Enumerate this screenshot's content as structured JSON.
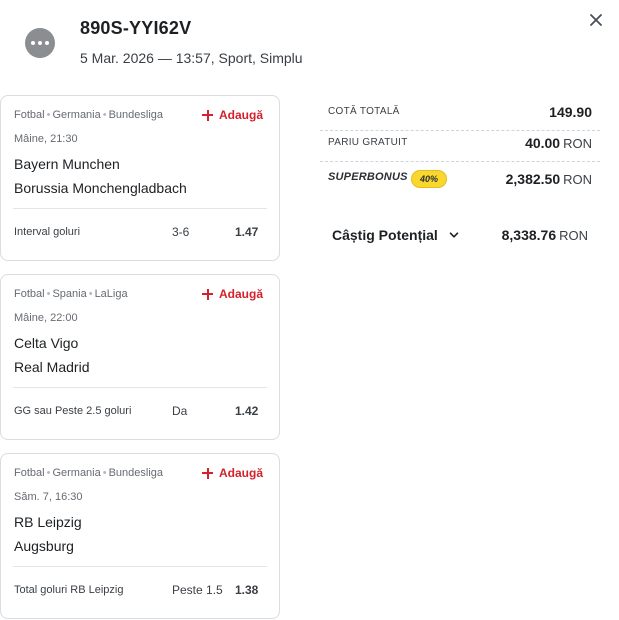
{
  "header": {
    "ticket_id": "890S-YYI62V",
    "meta": "5 Mar. 2026 — 13:57, Sport, Simplu"
  },
  "icons": {
    "avatar": "more-dots-icon",
    "close": "close-icon",
    "add": "plus-icon",
    "expand": "chevron-down-icon"
  },
  "bets": [
    {
      "sport": "Fotbal",
      "country": "Germania",
      "league": "Bundesliga",
      "add_label": "Adaugă",
      "when": "Mâine, 21:30",
      "home": "Bayern Munchen",
      "away": "Borussia Monchengladbach",
      "market": "Interval goluri",
      "pick": "3-6",
      "odd": "1.47"
    },
    {
      "sport": "Fotbal",
      "country": "Spania",
      "league": "LaLiga",
      "add_label": "Adaugă",
      "when": "Mâine, 22:00",
      "home": "Celta Vigo",
      "away": "Real Madrid",
      "market": "GG sau Peste 2.5 goluri",
      "pick": "Da",
      "odd": "1.42"
    },
    {
      "sport": "Fotbal",
      "country": "Germania",
      "league": "Bundesliga",
      "add_label": "Adaugă",
      "when": "Săm. 7, 16:30",
      "home": "RB Leipzig",
      "away": "Augsburg",
      "market": "Total goluri RB Leipzig",
      "pick": "Peste 1.5",
      "odd": "1.38"
    }
  ],
  "summary": {
    "total_odds_label": "COTĂ TOTALĂ",
    "total_odds": "149.90",
    "free_bet_label": "PARIU GRATUIT",
    "free_bet": "40.00",
    "superbonus_label": "SUPERBONUS",
    "superbonus_pct": "40%",
    "superbonus": "2,382.50",
    "currency": "RON",
    "potential_label": "Câștig Potențial",
    "potential": "8,338.76"
  },
  "colors": {
    "accent_red": "#d3212d",
    "bonus_yellow": "#f9d72e",
    "border": "#d9dce0"
  }
}
